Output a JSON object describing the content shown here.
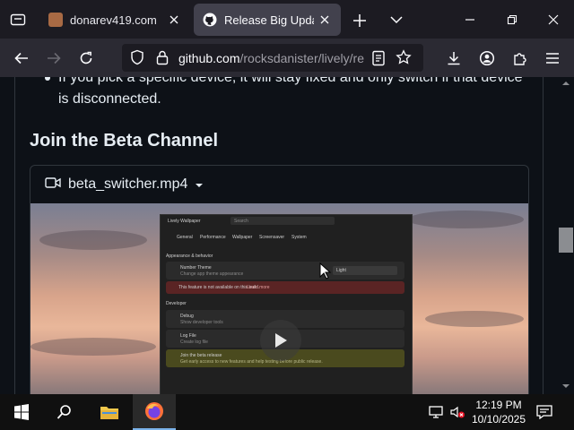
{
  "browser": {
    "tabs": [
      {
        "title": "donarev419.com",
        "active": false
      },
      {
        "title": "Release Big Update ·",
        "active": true
      }
    ],
    "url_domain": "github.com",
    "url_path": "/rocksdanister/lively/re"
  },
  "page": {
    "bullet_text": "If you pick a specific device, it will stay fixed and only switch if that device is disconnected.",
    "section_heading": "Join the Beta Channel",
    "video_filename": "beta_switcher.mp4"
  },
  "video_app": {
    "title": "Lively Wallpaper",
    "search_placeholder": "Search",
    "nav": [
      "General",
      "Performance",
      "Wallpaper",
      "Screensaver",
      "System"
    ],
    "section1": "Appearance & behavior",
    "row1_title": "Number Theme",
    "row1_sub": "Change app theme appearance",
    "row1_value": "Light",
    "warning": "This feature is not available on this build.",
    "warning_link": "Learn more",
    "section2": "Developer",
    "debug_title": "Debug",
    "debug_sub": "Show developer tools",
    "logfile_title": "Log File",
    "logfile_sub": "Create log file",
    "beta_title": "Join the beta release",
    "beta_sub": "Get early access to new features and help testing before public release."
  },
  "taskbar": {
    "time": "12:19 PM",
    "date": "10/10/2025"
  },
  "colors": {
    "accent": "#7bb3ea",
    "active_tab": "#42414d",
    "page_bg": "#0d1117"
  }
}
